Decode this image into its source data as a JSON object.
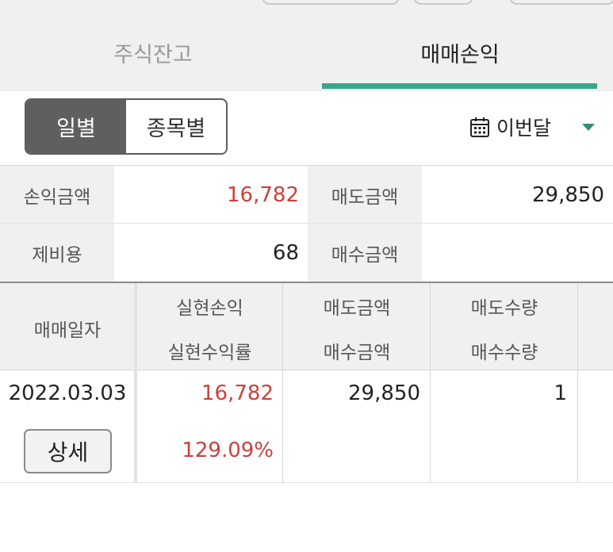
{
  "tabs": [
    {
      "label": "주식잔고",
      "active": false
    },
    {
      "label": "매매손익",
      "active": true
    }
  ],
  "segment": {
    "daily": "일별",
    "by_stock": "종목별",
    "selected": "일별"
  },
  "period": {
    "label": "이번달",
    "icon": "calendar-icon"
  },
  "summary": {
    "profit_label": "손익금액",
    "profit_value": "16,782",
    "sell_label": "매도금액",
    "sell_value": "29,850",
    "fee_label": "제비용",
    "fee_value": "68",
    "buy_label": "매수금액",
    "buy_value": ""
  },
  "table": {
    "headers": {
      "date": "매매일자",
      "realized_pl": "실현손익",
      "realized_rate": "실현수익률",
      "sell_amount": "매도금액",
      "buy_amount": "매수금액",
      "sell_qty": "매도수량",
      "buy_qty": "매수수량"
    },
    "rows": [
      {
        "date": "2022.03.03",
        "realized_pl": "16,782",
        "realized_rate": "129.09%",
        "sell_amount": "29,850",
        "buy_amount": "",
        "sell_qty": "1",
        "buy_qty": "",
        "detail_label": "상세"
      }
    ]
  },
  "colors": {
    "accent": "#3aa58b",
    "profit": "#c8423a",
    "segment_active": "#5f5f5f"
  }
}
